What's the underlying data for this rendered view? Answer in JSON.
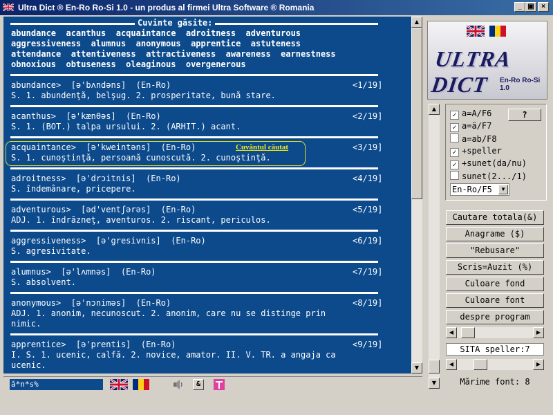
{
  "window": {
    "title": "Ultra Dict ® En-Ro Ro-Si 1.0 - un produs al firmei Ultra Software ® Romania",
    "buttons": {
      "minimize": "_",
      "restore": "▣",
      "close": "×"
    }
  },
  "found_words": {
    "header": "Cuvinte găsite:",
    "rows": [
      "abundance  acanthus  acquaintance  adroitness  adventurous",
      "aggressiveness  alumnus  anonymous  apprentice  astuteness",
      "attendance  attentiveness  attractiveness  awareness  earnestness",
      "obnoxious  obtuseness  oleaginous  overgenerous"
    ]
  },
  "entries": [
    {
      "head": "abundance>  [ə'bʌndəns]  (En-Ro)",
      "num": "<1/19]",
      "lines": [
        "S. 1. abundenţă, belşug. 2. prosperitate, bună stare."
      ]
    },
    {
      "head": "acanthus>  [ə'kænθəs]  (En-Ro)",
      "num": "<2/19]",
      "lines": [
        "S. 1. (BOT.) talpa ursului. 2. (ARHIT.) acant."
      ]
    },
    {
      "head": "acquaintance>  [ə'kweintəns]  (En-Ro)",
      "num": "<3/19]",
      "lines": [
        "S. 1. cunoştinţă, persoană cunoscută. 2. cunoştinţă."
      ]
    },
    {
      "head": "adroitness>  [ə'drɔitnis]  (En-Ro)",
      "num": "<4/19]",
      "lines": [
        "S. îndemânare, pricepere."
      ]
    },
    {
      "head": "adventurous>  [əd'ventʃərəs]  (En-Ro)",
      "num": "<5/19]",
      "lines": [
        "ADJ. 1. îndrăzneţ, aventuros. 2. riscant, periculos."
      ]
    },
    {
      "head": "aggressiveness>  [ə'gresivnis]  (En-Ro)",
      "num": "<6/19]",
      "lines": [
        "S. agresivitate."
      ]
    },
    {
      "head": "alumnus>  [ə'lʌmnəs]  (En-Ro)",
      "num": "<7/19]",
      "lines": [
        "S. absolvent."
      ]
    },
    {
      "head": "anonymous>  [ə'nɔniməs]  (En-Ro)",
      "num": "<8/19]",
      "lines": [
        "ADJ. 1. anonim, necunoscut. 2. anonim, care nu se distinge prin",
        "nimic."
      ]
    },
    {
      "head": "apprentice>  [ə'prentis]  (En-Ro)",
      "num": "<9/19]",
      "lines": [
        "I. S. 1. ucenic, calfă. 2. novice, amator. II. V. TR. a angaja ca",
        "ucenic."
      ]
    }
  ],
  "highlight_label": "Cuvântul căutat",
  "search_input": {
    "value": "ă*n*s%"
  },
  "logo": {
    "text": "ULTRA DICT",
    "sub": "En-Ro Ro-Si 1.0"
  },
  "options": [
    {
      "label": "a=A/F6",
      "checked": true
    },
    {
      "label": "a=ä/F7",
      "checked": true
    },
    {
      "label": "a=ab/F8",
      "checked": false
    },
    {
      "label": "+speller",
      "checked": true
    },
    {
      "label": "+sunet(da/nu)",
      "checked": true
    },
    {
      "label": "sunet(2.../1)",
      "checked": false
    }
  ],
  "help_button": "?",
  "direction_select": {
    "value": "En-Ro/F5"
  },
  "action_buttons": [
    "Cautare totala(&)",
    "Anagrame ($)",
    "\"Rebusare\"",
    "Scris=Auzit (%)",
    "Culoare fond",
    "Culoare font",
    "despre program"
  ],
  "speller_info": "SITA speller:7",
  "font_size_info": "Mărime font: 8",
  "colors": {
    "content_bg": "#0c4a8c",
    "highlight": "#e8e020",
    "title_start": "#0a246a",
    "title_end": "#3a6ea5"
  }
}
